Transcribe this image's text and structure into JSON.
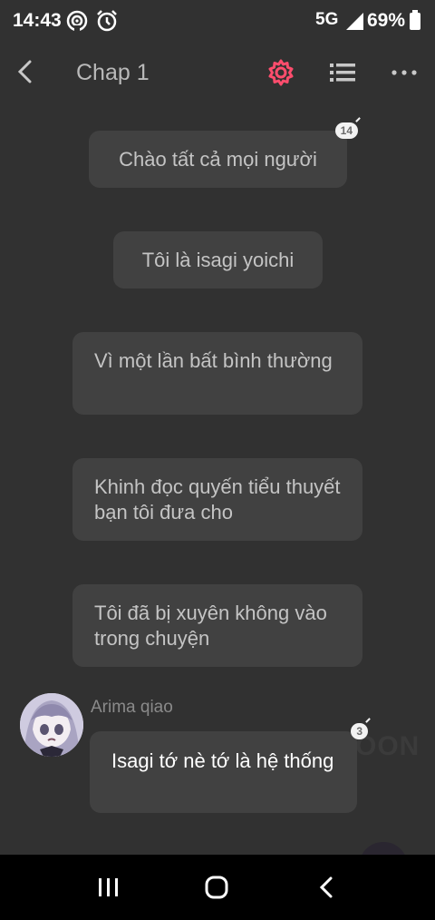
{
  "status_bar": {
    "time": "14:43",
    "network": "5G",
    "network_sub": "5G",
    "battery": "69%"
  },
  "header": {
    "title": "Chap 1",
    "accent_color": "#ff4d6d"
  },
  "messages": [
    {
      "text": "Chào tất cả mọi người",
      "badge": "14"
    },
    {
      "text": "Tôi là isagi yoichi"
    },
    {
      "text": "Vì một lần bất bình thường"
    },
    {
      "text": "Khinh đọc quyến tiểu thuyết bạn tôi đưa cho"
    },
    {
      "text": "Tôi đã bị xuyên không vào trong chuyện"
    }
  ],
  "character_message": {
    "name": "Arima qiao",
    "text": "Isagi tớ nè tớ là hệ thống",
    "badge": "3"
  },
  "watermark": "OON",
  "icons": [
    "hotspot-icon",
    "alarm-icon",
    "signal-icon",
    "battery-icon",
    "back-icon",
    "settings-icon",
    "list-icon",
    "more-icon",
    "recent-apps-icon",
    "home-icon",
    "nav-back-icon"
  ]
}
